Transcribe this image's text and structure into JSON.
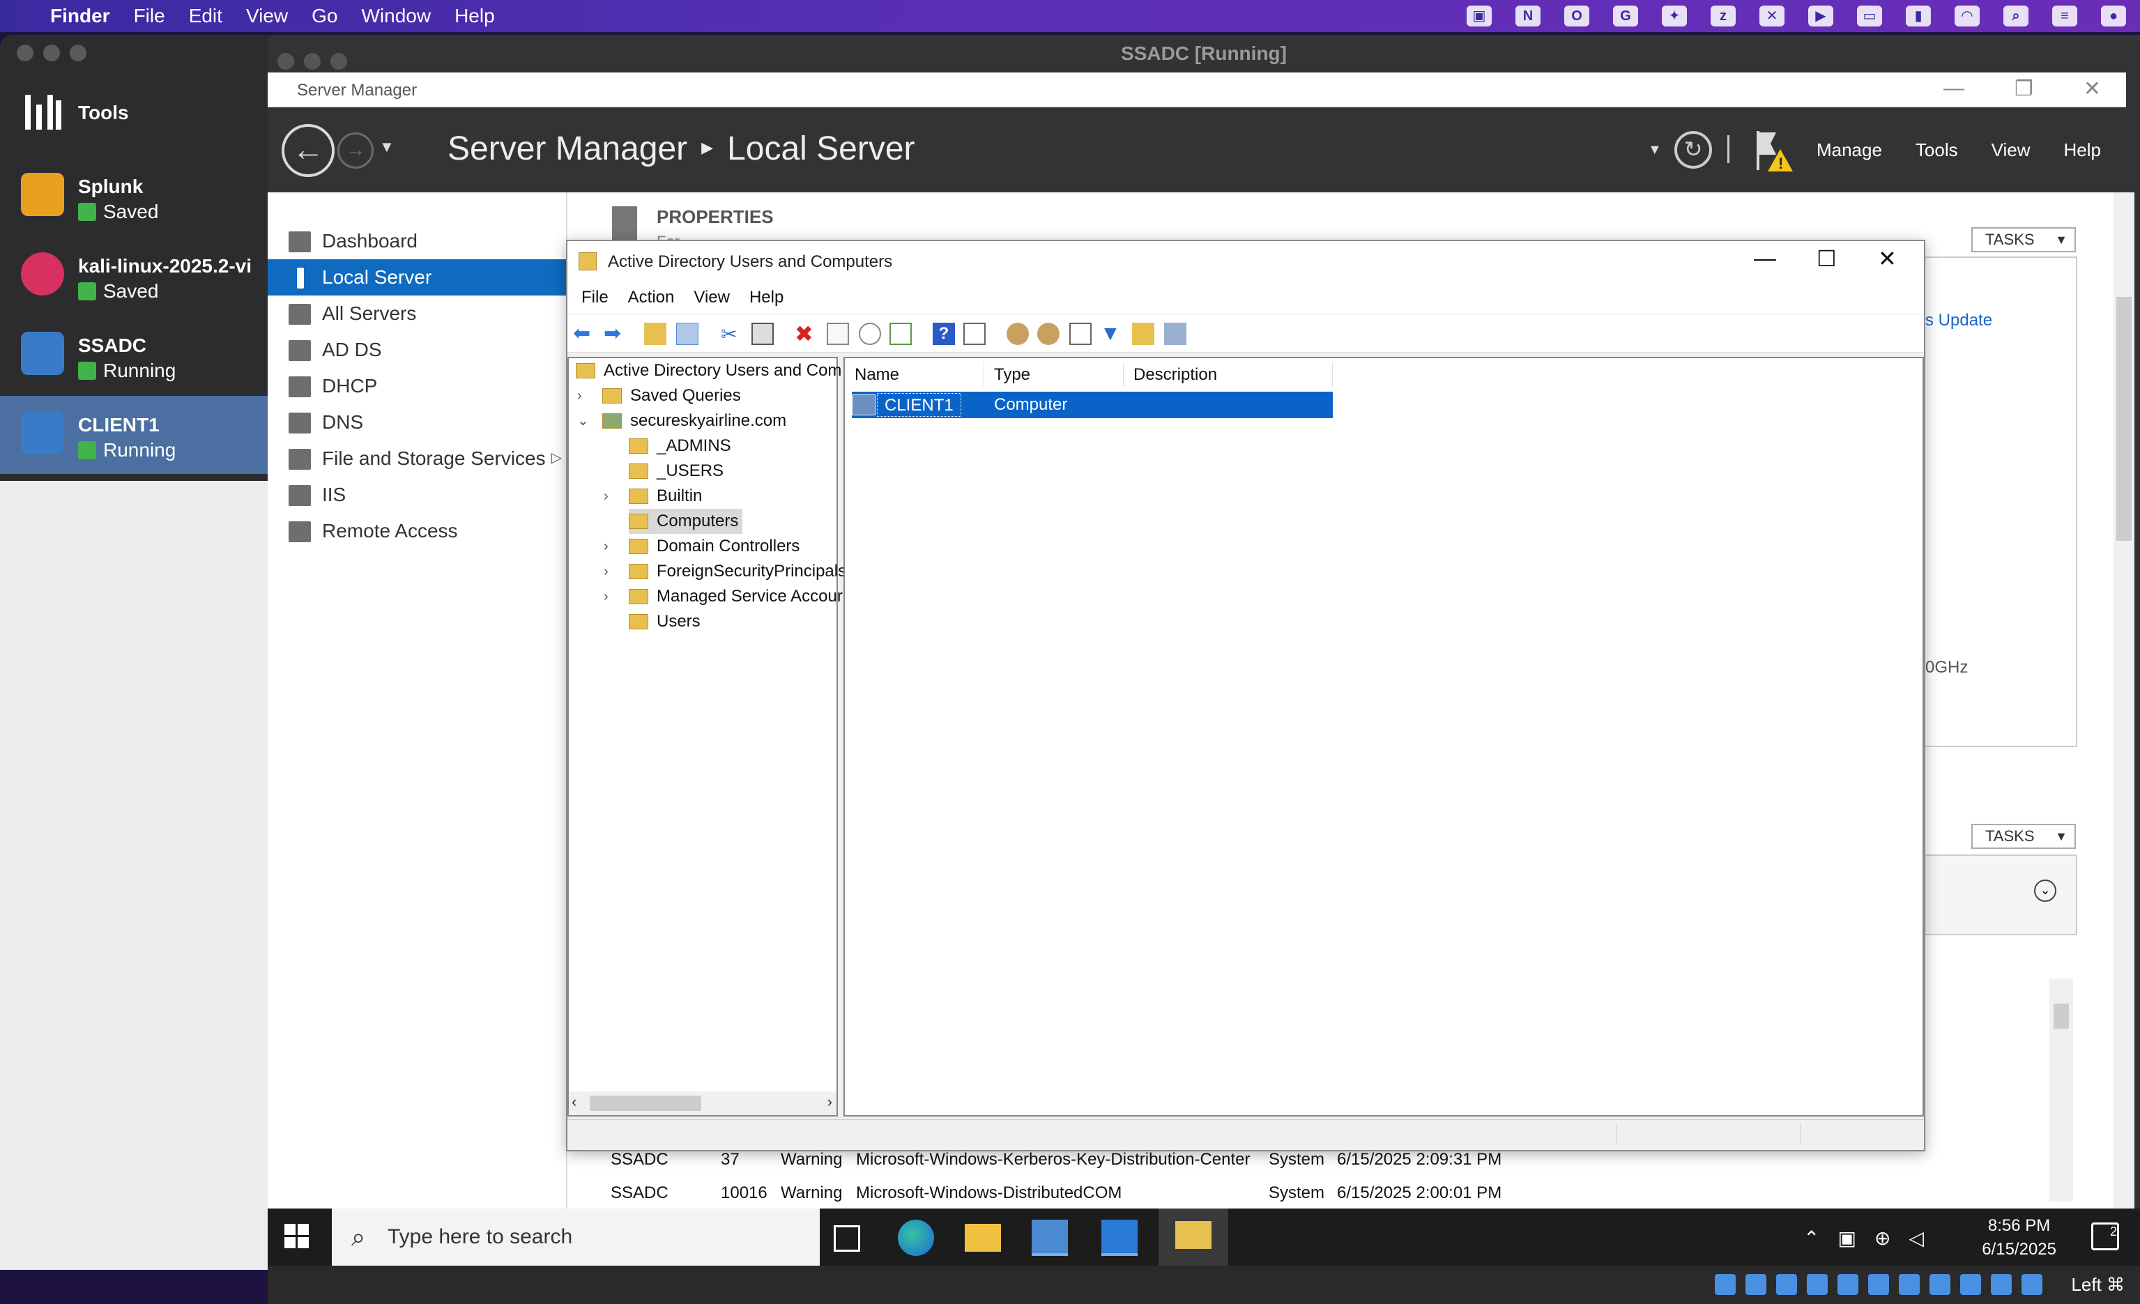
{
  "mac": {
    "menu": [
      "Finder",
      "File",
      "Edit",
      "View",
      "Go",
      "Window",
      "Help"
    ]
  },
  "vbox": {
    "tools_label": "Tools",
    "vms": [
      {
        "name": "Splunk",
        "state": "Saved",
        "color": "#e8a020"
      },
      {
        "name": "kali-linux-2025.2-vi",
        "state": "Saved",
        "color": "#d83060"
      },
      {
        "name": "SSADC",
        "state": "Running",
        "color": "#3a7bc8"
      },
      {
        "name": "CLIENT1",
        "state": "Running",
        "color": "#3a7bc8"
      }
    ],
    "window_title": "SSADC [Running]"
  },
  "server_manager": {
    "window_title": "Server Manager",
    "breadcrumb_root": "Server Manager",
    "breadcrumb_page": "Local Server",
    "menu": [
      "Manage",
      "Tools",
      "View",
      "Help"
    ],
    "nav": [
      "Dashboard",
      "Local Server",
      "All Servers",
      "AD DS",
      "DHCP",
      "DNS",
      "File and Storage Services",
      "IIS",
      "Remote Access"
    ],
    "properties_heading": "PROPERTIES",
    "properties_sub": "For SSADC",
    "tasks_label": "TASKS",
    "right_link": "s Update",
    "right_ghz": "0GHz"
  },
  "aduc": {
    "title": "Active Directory Users and Computers",
    "menu": [
      "File",
      "Action",
      "View",
      "Help"
    ],
    "tree_root": "Active Directory Users and Com",
    "tree": [
      "Saved Queries",
      "secureskyairline.com",
      "_ADMINS",
      "_USERS",
      "Builtin",
      "Computers",
      "Domain Controllers",
      "ForeignSecurityPrincipals",
      "Managed Service Accour",
      "Users"
    ],
    "columns": [
      "Name",
      "Type",
      "Description"
    ],
    "rows": [
      {
        "name": "CLIENT1",
        "type": "Computer",
        "description": ""
      }
    ]
  },
  "events": [
    {
      "server": "SSADC",
      "id": "37",
      "severity": "Warning",
      "source": "Microsoft-Windows-Kerberos-Key-Distribution-Center",
      "log": "System",
      "date": "6/15/2025 2:09:31 PM"
    },
    {
      "server": "SSADC",
      "id": "10016",
      "severity": "Warning",
      "source": "Microsoft-Windows-DistributedCOM",
      "log": "System",
      "date": "6/15/2025 2:00:01 PM"
    }
  ],
  "taskbar": {
    "search_placeholder": "Type here to search",
    "time": "8:56 PM",
    "date": "6/15/2025",
    "notif_count": "2"
  },
  "vm_status": {
    "host_key": "Left ⌘"
  }
}
